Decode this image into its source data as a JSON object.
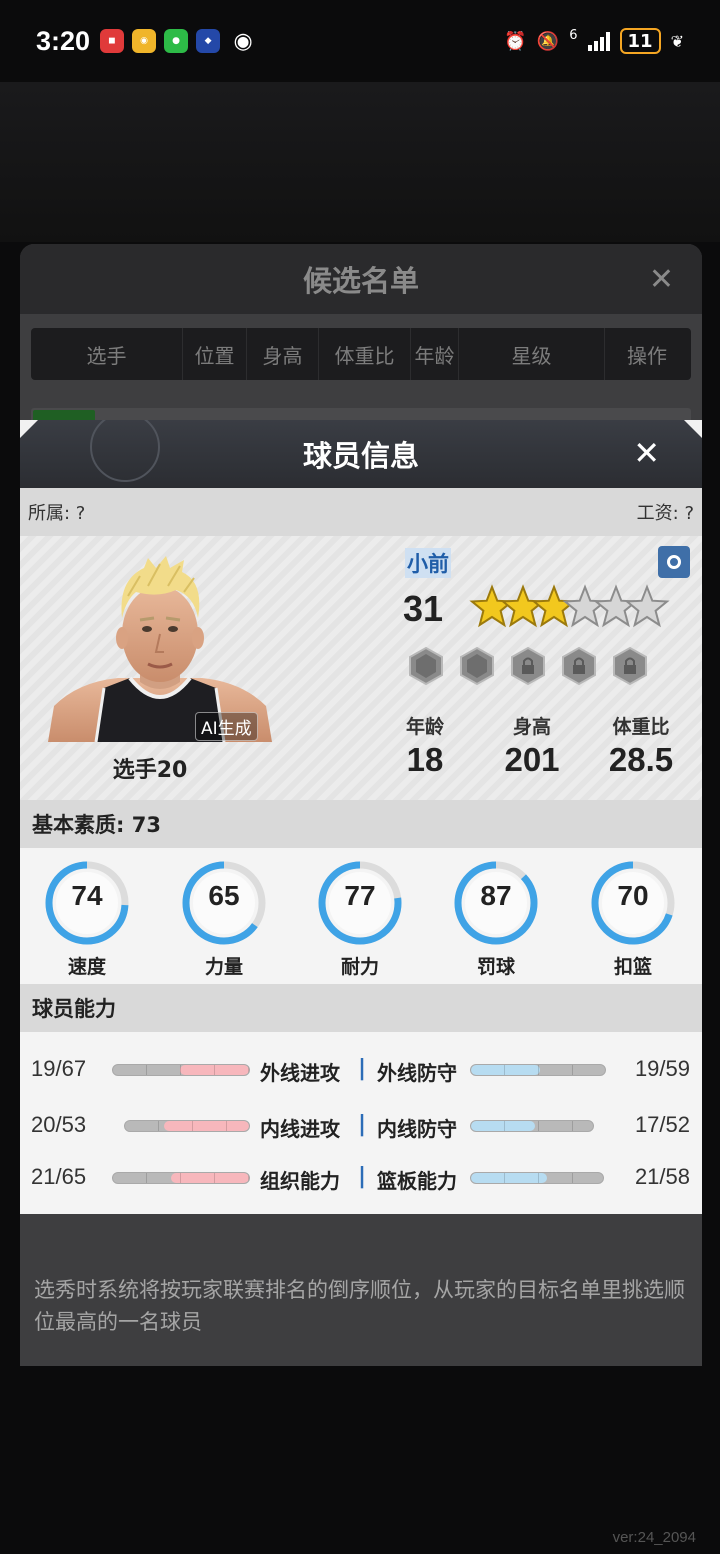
{
  "status_bar": {
    "time": "3:20",
    "battery": "11",
    "network": "6",
    "apps": [
      "huawei-icon",
      "weibo-icon",
      "wechat-icon",
      "app-icon",
      "eye-icon"
    ]
  },
  "background": {
    "title": "候选名单",
    "columns": [
      "选手",
      "位置",
      "身高",
      "体重比",
      "年龄",
      "星级",
      "操作"
    ],
    "note": "选秀时系统将按玩家联赛排名的倒序顺位，从玩家的目标名单里挑选顺位最高的一名球员",
    "version": "ver:24_2094"
  },
  "dialog": {
    "title": "球员信息",
    "affiliation": "所属: ?",
    "salary": "工资: ?",
    "position": "小前",
    "overall": "31",
    "stars": 3,
    "stars_max": 6,
    "ai_tag": "AI生成",
    "player_name": "选手20",
    "bio": [
      {
        "label": "年龄",
        "value": "18"
      },
      {
        "label": "身高",
        "value": "201"
      },
      {
        "label": "体重比",
        "value": "28.5"
      }
    ],
    "basic_quality": "基本素质: 73",
    "attributes": [
      {
        "label": "速度",
        "value": "74",
        "fraction": 0.74
      },
      {
        "label": "力量",
        "value": "65",
        "fraction": 0.65
      },
      {
        "label": "耐力",
        "value": "77",
        "fraction": 0.77
      },
      {
        "label": "罚球",
        "value": "87",
        "fraction": 0.87
      },
      {
        "label": "扣篮",
        "value": "70",
        "fraction": 0.7
      }
    ],
    "abilities_title": "球员能力",
    "abilities": [
      {
        "left_value": "19/67",
        "left_label": "外线进攻",
        "left_fraction": 0.28,
        "right_label": "外线防守",
        "right_value": "19/59",
        "right_fraction": 0.32
      },
      {
        "left_value": "20/53",
        "left_label": "内线进攻",
        "left_fraction": 0.38,
        "right_label": "内线防守",
        "right_value": "17/52",
        "right_fraction": 0.33
      },
      {
        "left_value": "21/65",
        "left_label": "组织能力",
        "left_fraction": 0.32,
        "right_label": "篮板能力",
        "right_value": "21/58",
        "right_fraction": 0.36
      }
    ]
  },
  "colors": {
    "ring_blue": "#3fa3e6",
    "ring_track": "#dcdcdc",
    "star_gold": "#f2c81e",
    "bar_red": "#f7b7bc",
    "bar_blue": "#b7dcf1"
  }
}
